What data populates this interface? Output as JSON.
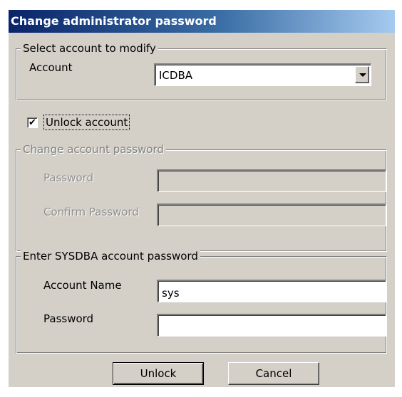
{
  "window": {
    "title": "Change administrator password"
  },
  "account_group": {
    "legend": "Select account to modify",
    "account_label": "Account",
    "account_value": "ICDBA"
  },
  "unlock": {
    "checked": true,
    "check_mark": "✔",
    "label": "Unlock account"
  },
  "password_group": {
    "legend": "Change account password",
    "password_label": "Password",
    "password_value": "",
    "confirm_label": "Confirm Password",
    "confirm_value": "",
    "disabled": true
  },
  "sysdba_group": {
    "legend": "Enter SYSDBA account password",
    "account_name_label": "Account Name",
    "account_name_value": "sys",
    "password_label": "Password",
    "password_value": ""
  },
  "buttons": {
    "unlock_label": "Unlock",
    "cancel_label": "Cancel"
  },
  "colors": {
    "face": "#d4d0c8",
    "title_start": "#0a246a",
    "title_end": "#a6caf0",
    "disabled_text": "#8f8f8f"
  }
}
